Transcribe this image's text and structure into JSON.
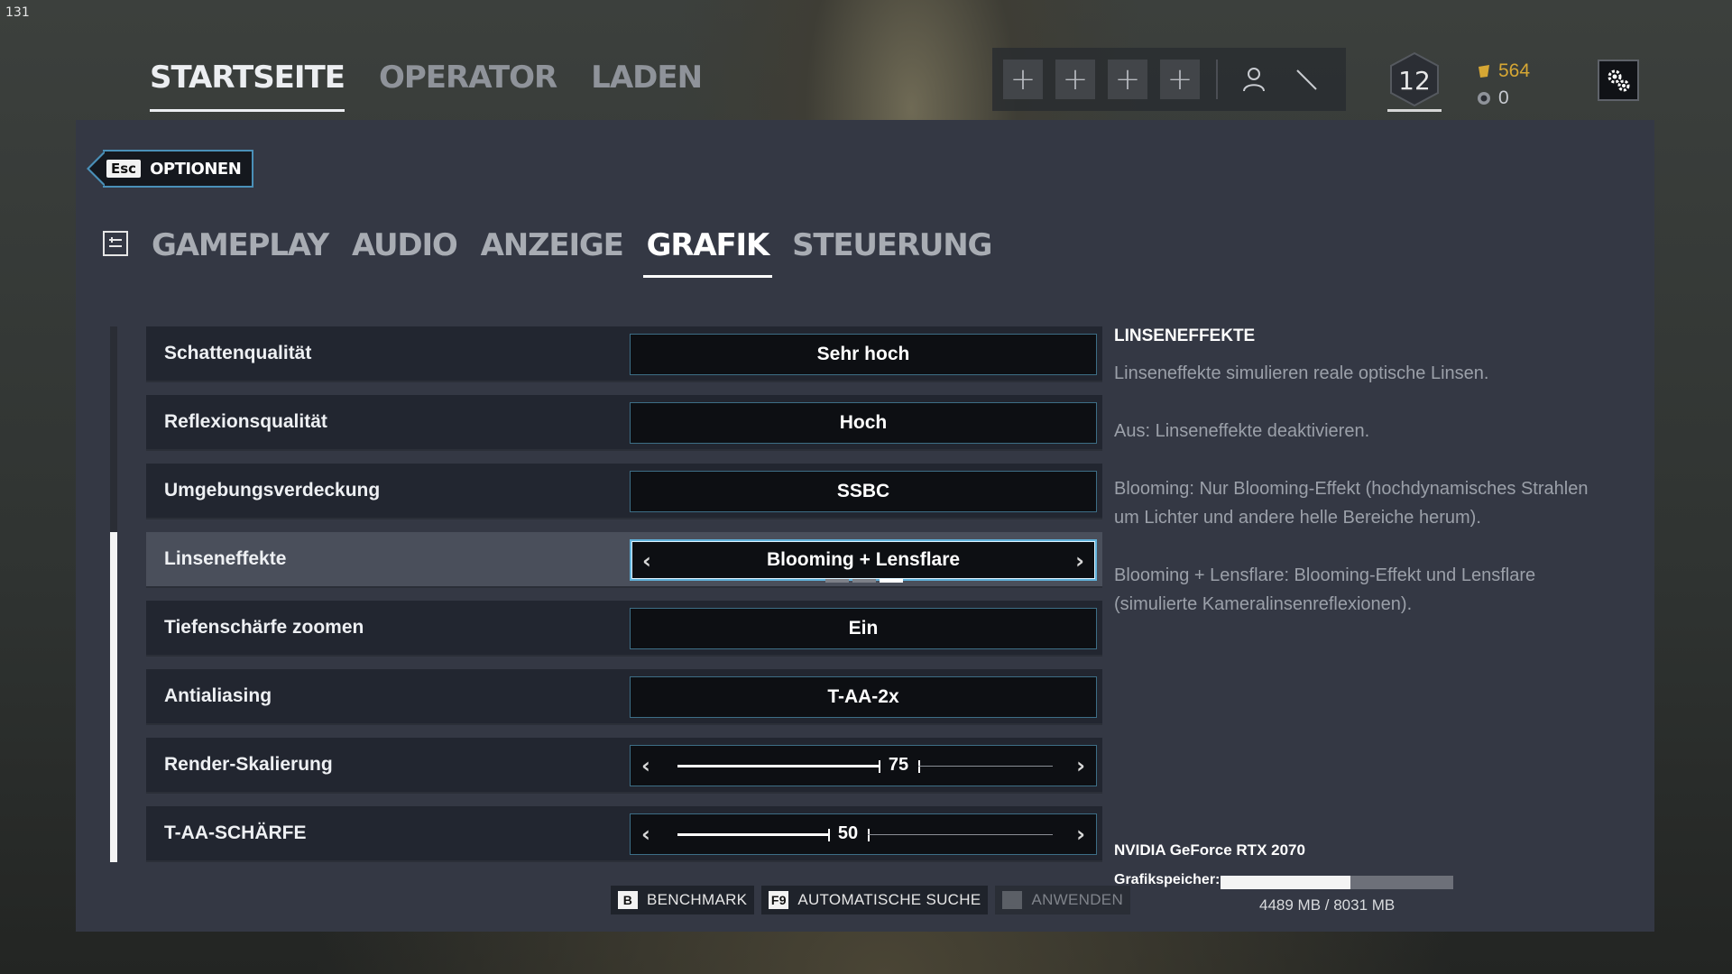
{
  "fps": "131",
  "topnav": {
    "items": [
      "STARTSEITE",
      "OPERATOR",
      "LADEN"
    ]
  },
  "squad": {
    "slots": [
      "+",
      "+",
      "+",
      "+"
    ]
  },
  "profile": {
    "level": "12",
    "renown": "564",
    "credits": "0"
  },
  "options": {
    "esc_key": "Esc",
    "back_label": "OPTIONEN"
  },
  "tabs": [
    "GAMEPLAY",
    "AUDIO",
    "ANZEIGE",
    "GRAFIK",
    "STEUERUNG"
  ],
  "settings": [
    {
      "label": "Schattenqualität",
      "value": "Sehr hoch"
    },
    {
      "label": "Reflexionsqualität",
      "value": "Hoch"
    },
    {
      "label": "Umgebungsverdeckung",
      "value": "SSBC"
    },
    {
      "label": "Linseneffekte",
      "value": "Blooming + Lensflare",
      "selected_index": 2,
      "option_count": 3
    },
    {
      "label": "Tiefenschärfe zoomen",
      "value": "Ein"
    },
    {
      "label": "Antialiasing",
      "value": "T-AA-2x"
    },
    {
      "label": "Render-Skalierung",
      "value": "75",
      "fraction": 0.6
    },
    {
      "label": "T-AA-SCHÄRFE",
      "value": "50",
      "fraction": 0.45
    }
  ],
  "info": {
    "title": "LINSENEFFEKTE",
    "paragraphs": [
      "Linseneffekte simulieren reale optische Linsen.",
      "Aus: Linseneffekte deaktivieren.",
      "Blooming: Nur Blooming-Effekt (hochdynamisches Strahlen um Lichter und andere helle Bereiche herum).",
      "Blooming + Lensflare: Blooming-Effekt und Lensflare (simulierte Kameralinsenreflexionen)."
    ]
  },
  "gpu": {
    "name": "NVIDIA GeForce RTX 2070",
    "memory_label": "Grafikspeicher:",
    "memory_text": "4489 MB / 8031 MB",
    "used_fraction": 0.559
  },
  "actions": [
    {
      "key": "B",
      "label": "BENCHMARK",
      "enabled": true
    },
    {
      "key": "F9",
      "label": "AUTOMATISCHE SUCHE",
      "enabled": true
    },
    {
      "key": "",
      "label": "ANWENDEN",
      "enabled": false
    }
  ],
  "colors": {
    "accent": "#60b3dc",
    "renown": "#d6a734",
    "panel": "#343844"
  }
}
